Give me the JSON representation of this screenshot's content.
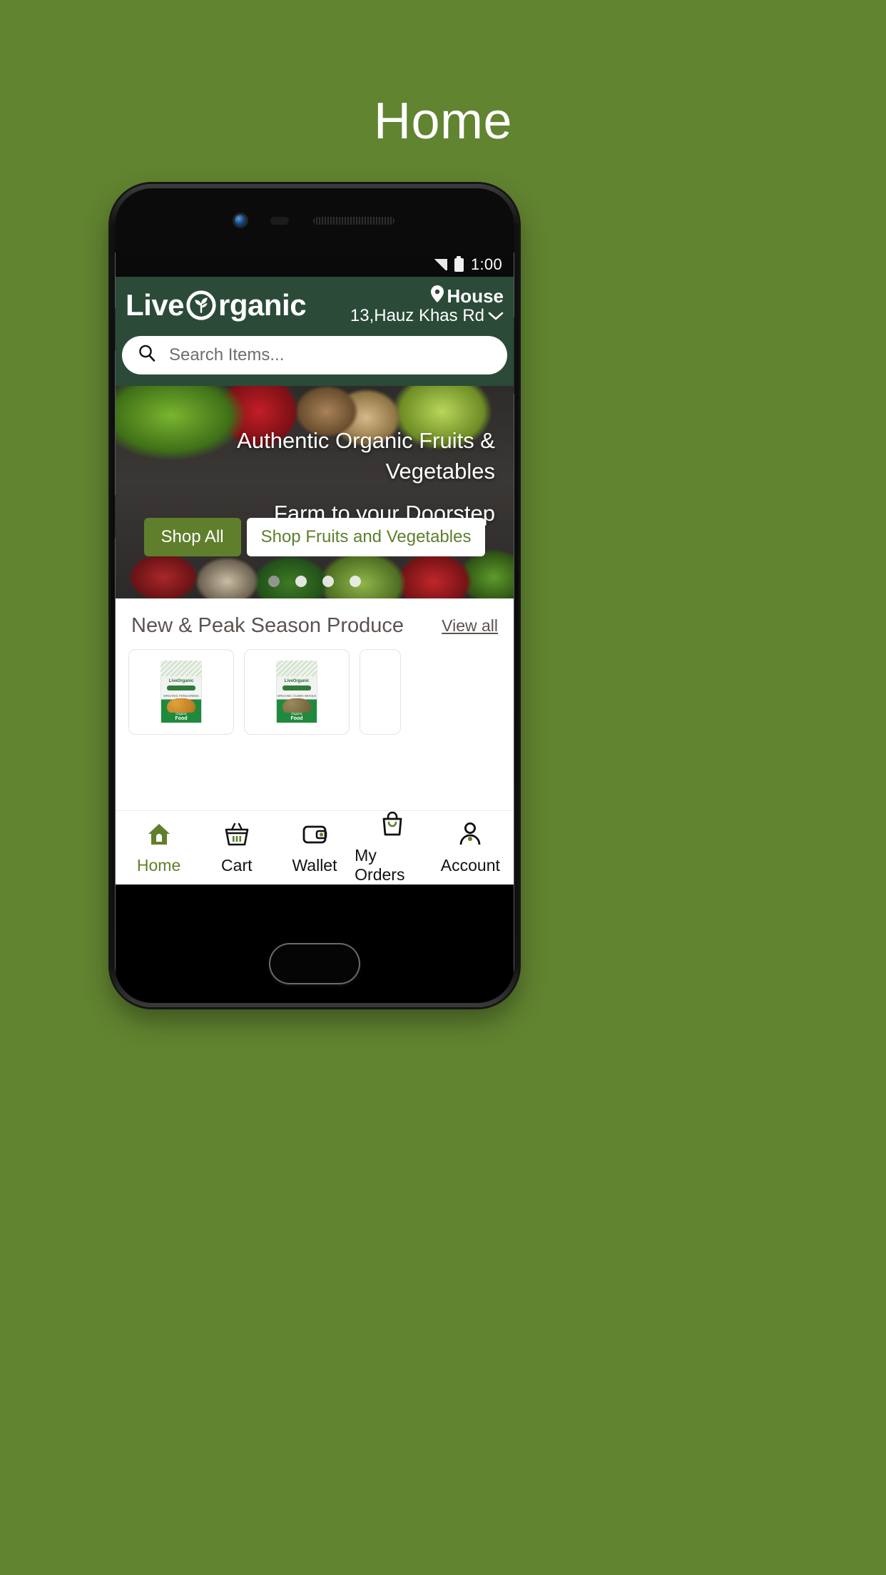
{
  "page": {
    "title": "Home",
    "bg_color": "#618430"
  },
  "status_bar": {
    "time": "1:00",
    "signal_icon": "signal-bars-icon",
    "battery_icon": "battery-icon"
  },
  "app_header": {
    "brand_part1": "Live",
    "brand_part2": "rganic",
    "logo_icon": "leaf-in-circle-icon",
    "location": {
      "pin_icon": "location-pin-icon",
      "line1": "House",
      "line2": "13,Hauz Khas Rd",
      "chevron_icon": "chevron-down-icon"
    },
    "bg_color": "#2b4a38"
  },
  "search": {
    "placeholder": "Search Items...",
    "icon": "search-icon"
  },
  "hero": {
    "headline_line1": "Authentic Organic Fruits &",
    "headline_line2": "Vegetables",
    "subline": "Farm to your Doorstep",
    "primary_button": "Shop All",
    "secondary_button": "Shop Fruits and Vegetables",
    "dots_total": 4,
    "active_dot_index": 0,
    "primary_button_color": "#5f7f2c"
  },
  "section": {
    "title": "New & Peak Season Produce",
    "view_all": "View all",
    "cards": [
      {
        "name": "organic-seeds-pack",
        "brand": "LiveOrganic",
        "product_line": "ORGANIC FENUGREEK SEEDS",
        "footer_small": "Organic",
        "footer_big": "Food",
        "variant": "seeds"
      },
      {
        "name": "organic-cumin-pack",
        "brand": "LiveOrganic",
        "product_line": "ORGANIC CUMIN WHOLE",
        "footer_small": "Organic",
        "footer_big": "Food",
        "variant": "cumin"
      },
      {
        "name": "organic-pack-partial",
        "brand": "",
        "product_line": "",
        "footer_small": "",
        "footer_big": "",
        "variant": "partial"
      }
    ]
  },
  "bottom_nav": {
    "active_index": 0,
    "active_color": "#5f7f2c",
    "items": [
      {
        "label": "Home",
        "icon": "home-icon"
      },
      {
        "label": "Cart",
        "icon": "basket-icon"
      },
      {
        "label": "Wallet",
        "icon": "wallet-icon"
      },
      {
        "label": "My Orders",
        "icon": "shopping-bag-icon"
      },
      {
        "label": "Account",
        "icon": "person-icon"
      }
    ]
  }
}
